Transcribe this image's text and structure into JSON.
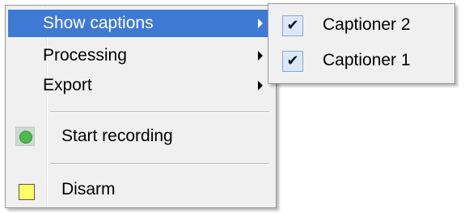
{
  "main_menu": {
    "items": [
      {
        "label": "Show captions",
        "has_submenu": true,
        "highlighted": true
      },
      {
        "label": "Processing",
        "has_submenu": true
      },
      {
        "label": "Export",
        "has_submenu": true
      },
      {
        "label": "Start recording",
        "icon": "green-dot-icon"
      },
      {
        "label": "Disarm",
        "icon": "yellow-square-icon"
      }
    ]
  },
  "submenu": {
    "items": [
      {
        "label": "Captioner 2",
        "checked": true,
        "check_glyph": "✔"
      },
      {
        "label": "Captioner 1",
        "checked": true,
        "check_glyph": "✔"
      }
    ]
  },
  "colors": {
    "highlight": "#3f79d6",
    "menu_background": "#f0f0f0",
    "recording_green": "#4dbb4d",
    "disarm_yellow": "#ffff66"
  }
}
